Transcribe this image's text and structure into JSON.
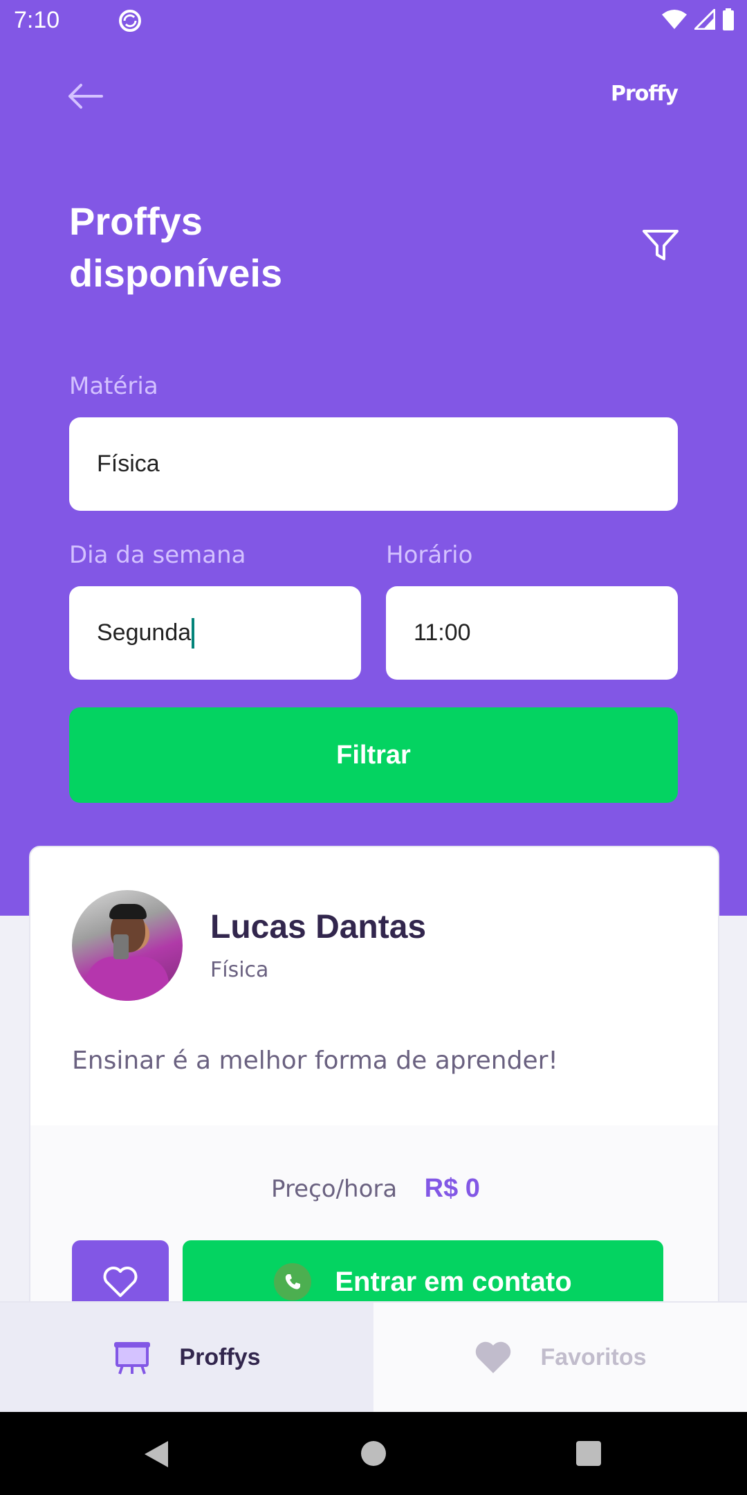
{
  "status_bar": {
    "time": "7:10"
  },
  "header": {
    "logo": "Proffy",
    "title_line1": "Proffys",
    "title_line2": "disponíveis"
  },
  "filters": {
    "subject_label": "Matéria",
    "subject_value": "Física",
    "weekday_label": "Dia da semana",
    "weekday_value": "Segunda",
    "time_label": "Horário",
    "time_value": "11:00",
    "submit_label": "Filtrar"
  },
  "teacher_card": {
    "name": "Lucas Dantas",
    "subject": "Física",
    "bio": "Ensinar é a melhor forma de aprender!",
    "price_label": "Preço/hora",
    "price_value": "R$ 0",
    "contact_label": "Entrar em contato"
  },
  "tabs": [
    {
      "label": "Proffys",
      "icon": "easel-icon",
      "active": true
    },
    {
      "label": "Favoritos",
      "icon": "heart-icon",
      "active": false
    }
  ],
  "colors": {
    "primary": "#8257E5",
    "secondary": "#04D361",
    "title_dark": "#32264D",
    "text_muted": "#6A6180",
    "label_light": "#D4C2FF",
    "background": "#F0F0F7"
  }
}
